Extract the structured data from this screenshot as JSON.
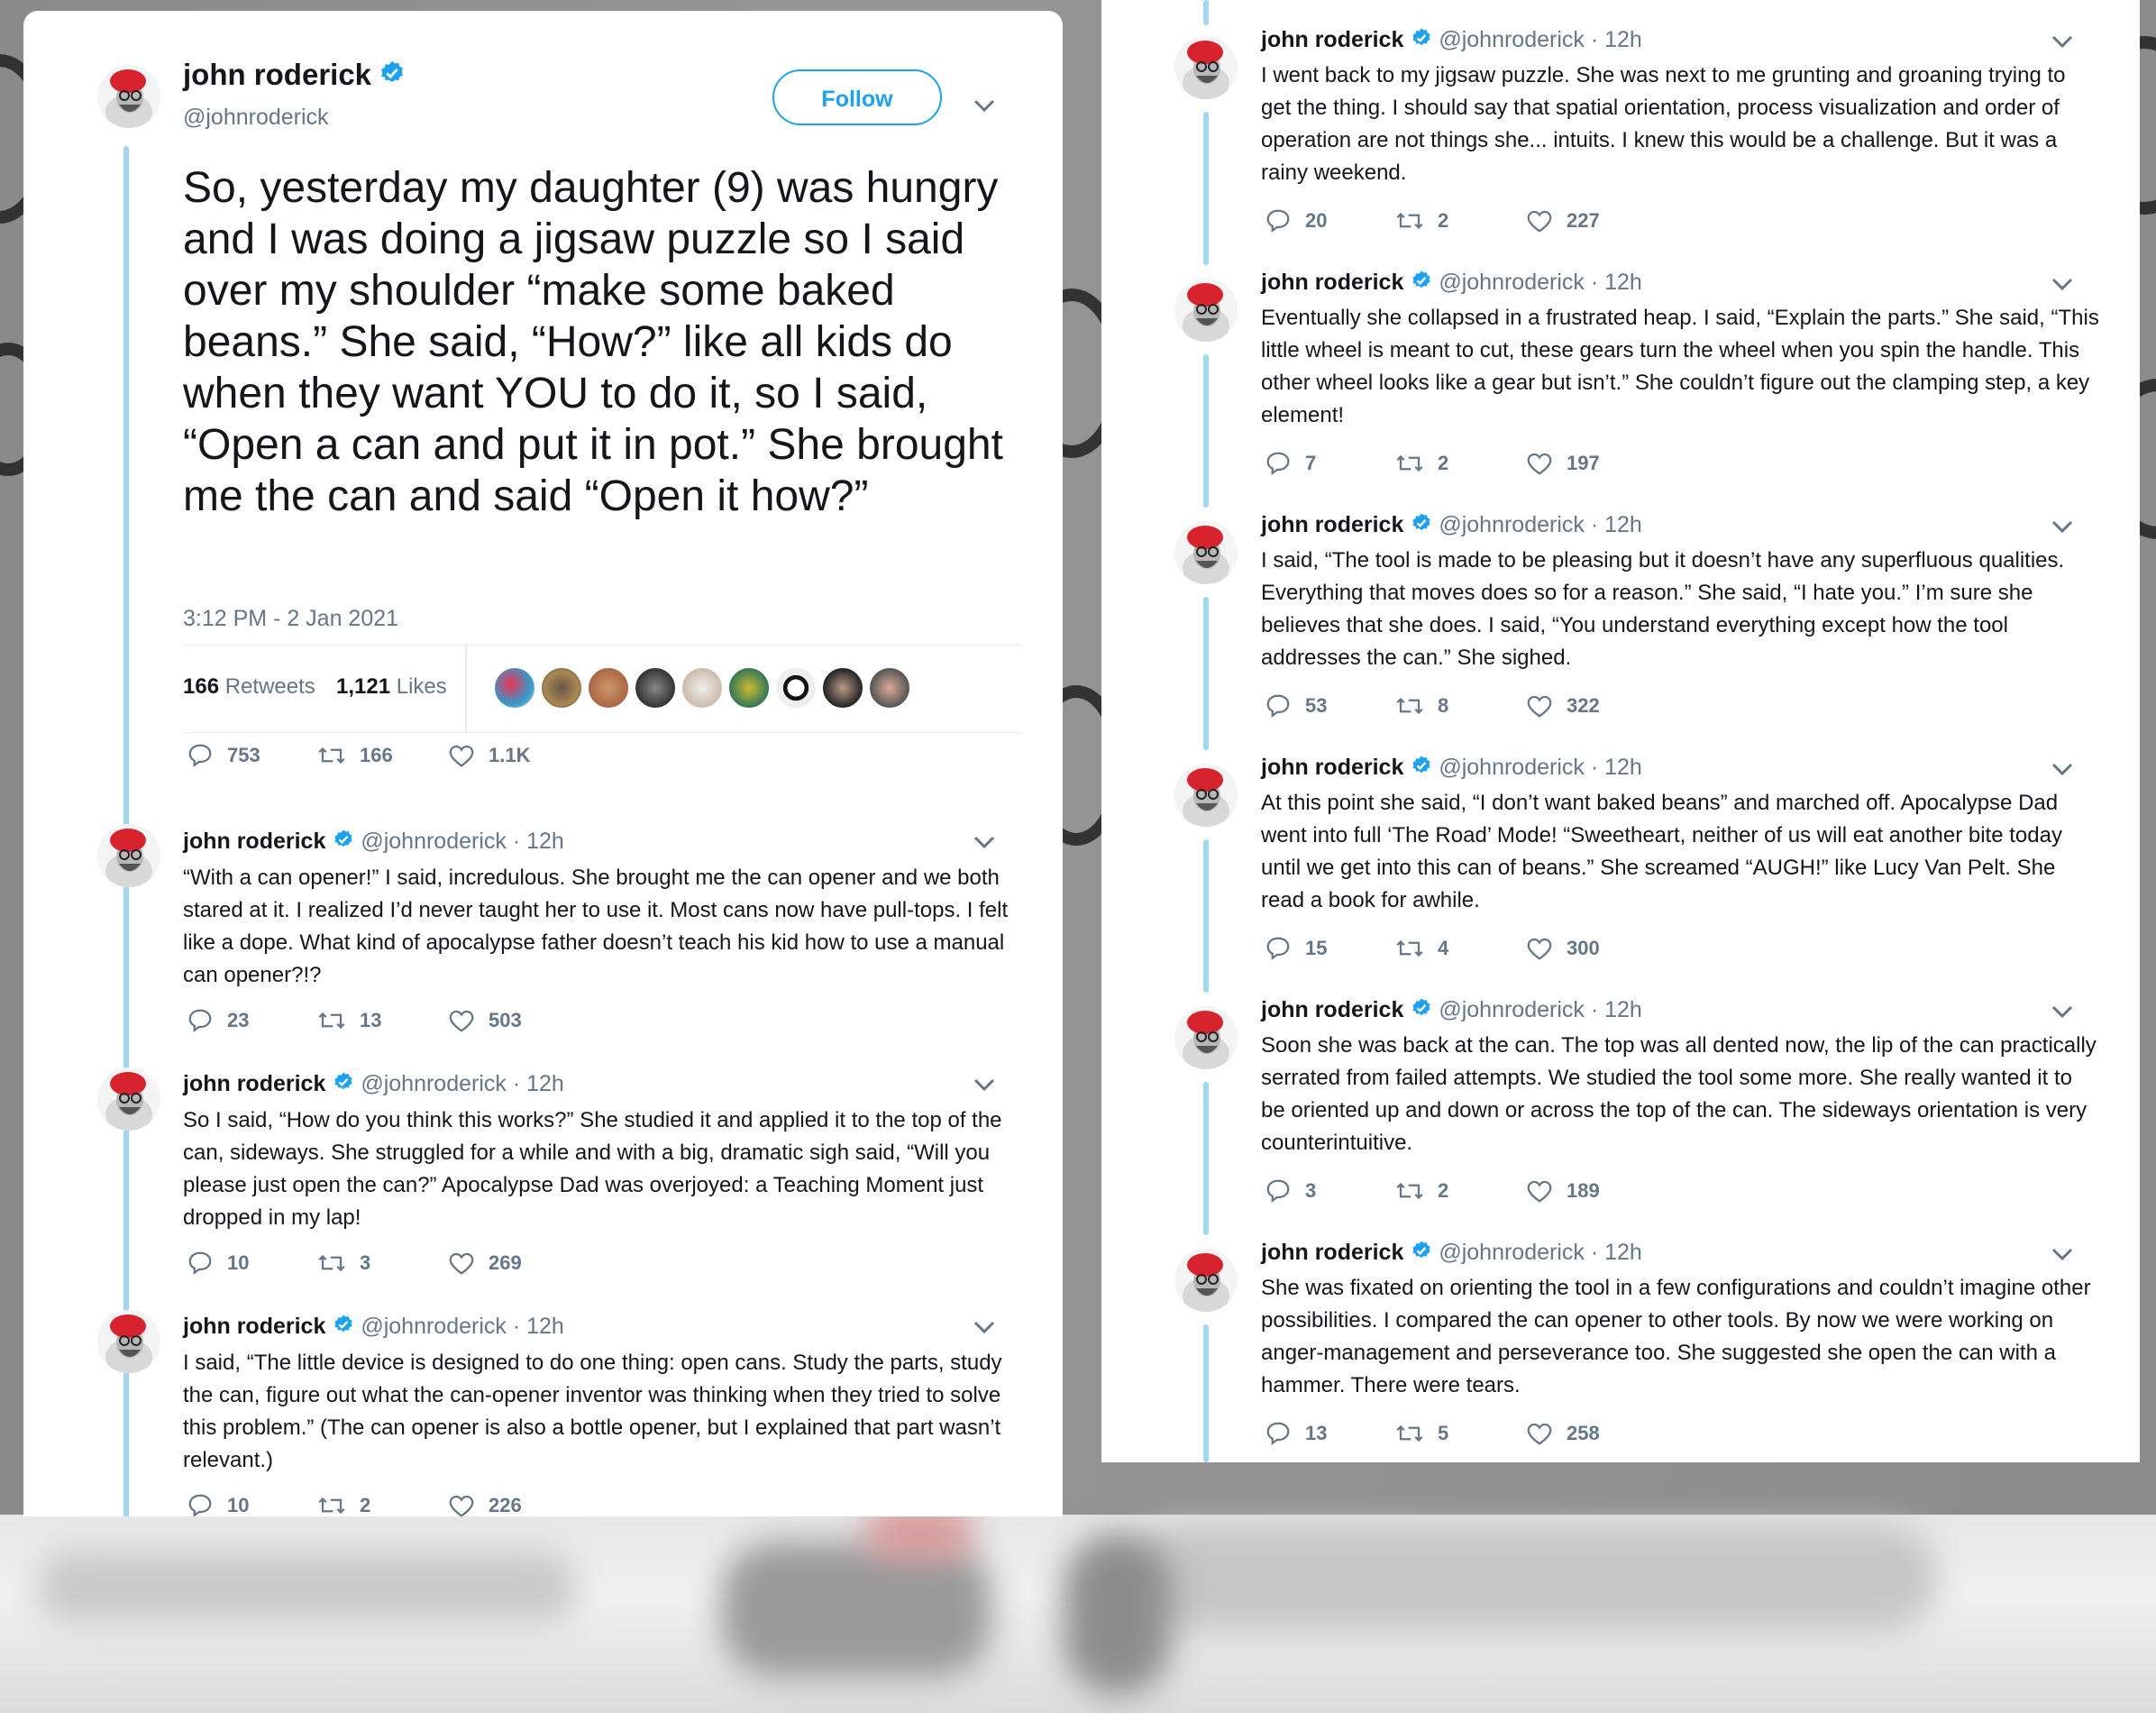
{
  "author": {
    "name": "john roderick",
    "handle": "@johnroderick",
    "age": "12h",
    "separator": "·"
  },
  "follow_label": "Follow",
  "main_tweet": {
    "text": "So, yesterday my daughter (9) was hungry and I was doing a jigsaw puzzle so I said over my shoulder “make some baked beans.” She said, “How?” like all kids do when they want YOU to do it, so I said, “Open a can and put it in pot.” She brought me the can and said “Open it how?”",
    "timestamp": "3:12 PM - 2 Jan 2021",
    "retweets_count": "166",
    "retweets_label": "Retweets",
    "likes_count": "1,121",
    "likes_label": "Likes",
    "replies": "753",
    "rts": "166",
    "favs": "1.1K"
  },
  "left_replies": [
    {
      "text": "“With a can opener!” I said, incredulous. She brought me the can opener and we both stared at it. I realized I’d never taught her to use it. Most cans now have pull-tops. I felt like a dope. What kind of apocalypse father doesn’t teach his kid how to use a manual can opener?!?",
      "replies": "23",
      "retweets": "13",
      "likes": "503"
    },
    {
      "text": "So I said, “How do you think this works?” She studied it and applied it to the top of the can, sideways. She struggled for a while and with a big, dramatic sigh said, “Will you please just open the can?” Apocalypse Dad was overjoyed: a Teaching Moment just dropped in my lap!",
      "replies": "10",
      "retweets": "3",
      "likes": "269"
    },
    {
      "text": "I said, “The little device is designed to do one thing: open cans. Study the parts, study the can, figure out what the can-opener inventor was thinking when they tried to solve this problem.” (The can opener is also a bottle opener, but I explained that part wasn’t relevant.)",
      "replies": "10",
      "retweets": "2",
      "likes": "226"
    }
  ],
  "right_replies": [
    {
      "text": "I went back to my jigsaw puzzle. She was next to me grunting and groaning trying to get the thing. I should say that spatial orientation, process visualization and order of operation are not things she... intuits. I knew this would be a challenge. But it was a rainy weekend.",
      "replies": "20",
      "retweets": "2",
      "likes": "227"
    },
    {
      "text": "Eventually she collapsed in a frustrated heap. I said, “Explain the parts.” She said, “This little wheel is meant to cut, these gears turn the wheel when you spin the handle. This other wheel looks like a gear but isn’t.” She couldn’t figure out the clamping step, a key element!",
      "replies": "7",
      "retweets": "2",
      "likes": "197"
    },
    {
      "text": "I said, “The tool is made to be pleasing but it doesn’t have any superfluous qualities. Everything that moves does so for a reason.” She said, “I hate you.” I’m sure she believes that she does. I said, “You understand everything except how the tool addresses the can.” She sighed.",
      "replies": "53",
      "retweets": "8",
      "likes": "322"
    },
    {
      "text": "At this point she said, “I don’t want baked beans” and marched off. Apocalypse Dad went into full ‘The Road’ Mode! “Sweetheart, neither of us will eat another bite today until we get into this can of beans.” She screamed “AUGH!” like Lucy Van Pelt. She read a book for awhile.",
      "replies": "15",
      "retweets": "4",
      "likes": "300"
    },
    {
      "text": "Soon she was back at the can. The top was all dented now, the lip of the can practically serrated from failed attempts. We studied the tool some more. She really wanted it to be oriented up and down or across the top of the can. The sideways orientation is very counterintuitive.",
      "replies": "3",
      "retweets": "2",
      "likes": "189"
    },
    {
      "text": "She was fixated on orienting the tool in a few configurations and couldn’t imagine other possibilities. I compared the can opener to other tools. By now we were working on anger-management and perseverance too. She suggested she open the can with a hammer. There were tears.",
      "replies": "13",
      "retweets": "5",
      "likes": "258"
    }
  ],
  "colors": {
    "accent": "#1da1f2",
    "thread_line": "#9fd7f4",
    "muted": "#657786",
    "text": "#14171a"
  },
  "icons": [
    "verified-badge-icon",
    "chevron-down-icon",
    "reply-icon",
    "retweet-icon",
    "like-icon",
    "avatar-icon"
  ]
}
